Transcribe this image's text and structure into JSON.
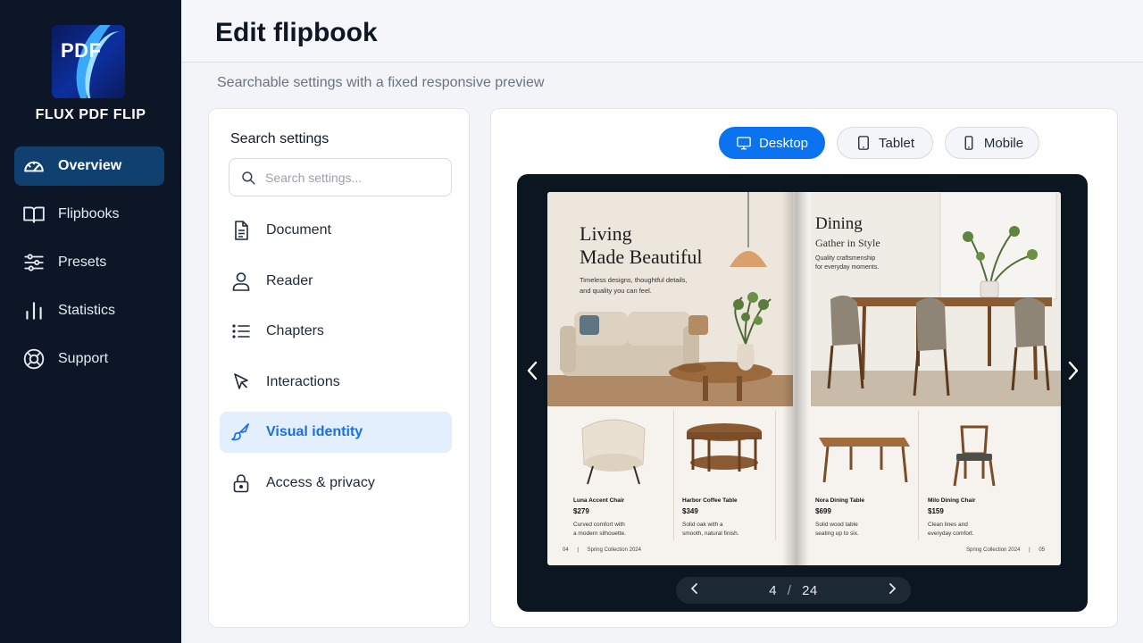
{
  "app": {
    "brand": "FLUX PDF FLIP",
    "logo_text": "PDF"
  },
  "sidebar": {
    "items": [
      {
        "label": "Overview",
        "icon": "gauge-icon",
        "active": true
      },
      {
        "label": "Flipbooks",
        "icon": "book-open-icon",
        "active": false
      },
      {
        "label": "Presets",
        "icon": "sliders-icon",
        "active": false
      },
      {
        "label": "Statistics",
        "icon": "bar-chart-icon",
        "active": false
      },
      {
        "label": "Support",
        "icon": "lifebuoy-icon",
        "active": false
      }
    ]
  },
  "header": {
    "title": "Edit flipbook",
    "subtitle": "Searchable settings with a fixed responsive preview"
  },
  "settings": {
    "title": "Search settings",
    "search_placeholder": "Search settings...",
    "items": [
      {
        "label": "Document",
        "icon": "document-icon",
        "active": false
      },
      {
        "label": "Reader",
        "icon": "user-icon",
        "active": false
      },
      {
        "label": "Chapters",
        "icon": "list-icon",
        "active": false
      },
      {
        "label": "Interactions",
        "icon": "cursor-icon",
        "active": false
      },
      {
        "label": "Visual identity",
        "icon": "brush-icon",
        "active": true
      },
      {
        "label": "Access & privacy",
        "icon": "lock-icon",
        "active": false
      }
    ]
  },
  "preview": {
    "devices": [
      {
        "label": "Desktop",
        "icon": "monitor-icon",
        "active": true
      },
      {
        "label": "Tablet",
        "icon": "tablet-icon",
        "active": false
      },
      {
        "label": "Mobile",
        "icon": "mobile-icon",
        "active": false
      }
    ],
    "book": {
      "left": {
        "title_line1": "Living",
        "title_line2": "Made Beautiful",
        "desc_line1": "Timeless designs, thoughtful details,",
        "desc_line2": "and quality you can feel.",
        "products": [
          {
            "name": "Luna Accent Chair",
            "price": "$279",
            "desc_line1": "Curved comfort with",
            "desc_line2": "a modern silhouette."
          },
          {
            "name": "Harbor Coffee Table",
            "price": "$349",
            "desc_line1": "Solid oak with a",
            "desc_line2": "smooth, natural finish."
          }
        ],
        "page_number": "04",
        "footer": "Spring Collection 2024"
      },
      "right": {
        "title": "Dining",
        "subtitle": "Gather in Style",
        "desc_line1": "Quality craftsmenship",
        "desc_line2": "for everyday moments.",
        "products": [
          {
            "name": "Nora Dining Table",
            "price": "$699",
            "desc_line1": "Solid wood table",
            "desc_line2": "seating up to six."
          },
          {
            "name": "Milo Dining Chair",
            "price": "$159",
            "desc_line1": "Clean lines and",
            "desc_line2": "everyday comfort."
          }
        ],
        "page_number": "05",
        "footer": "Spring Collection 2024"
      }
    },
    "pager": {
      "current": "4",
      "separator": "/",
      "total": "24"
    }
  },
  "colors": {
    "sidebar_bg": "#0c1626",
    "accent": "#0b72f0",
    "active_nav": "#10406f",
    "active_setting_bg": "#e3effc",
    "stage_bg": "#0b1620"
  }
}
